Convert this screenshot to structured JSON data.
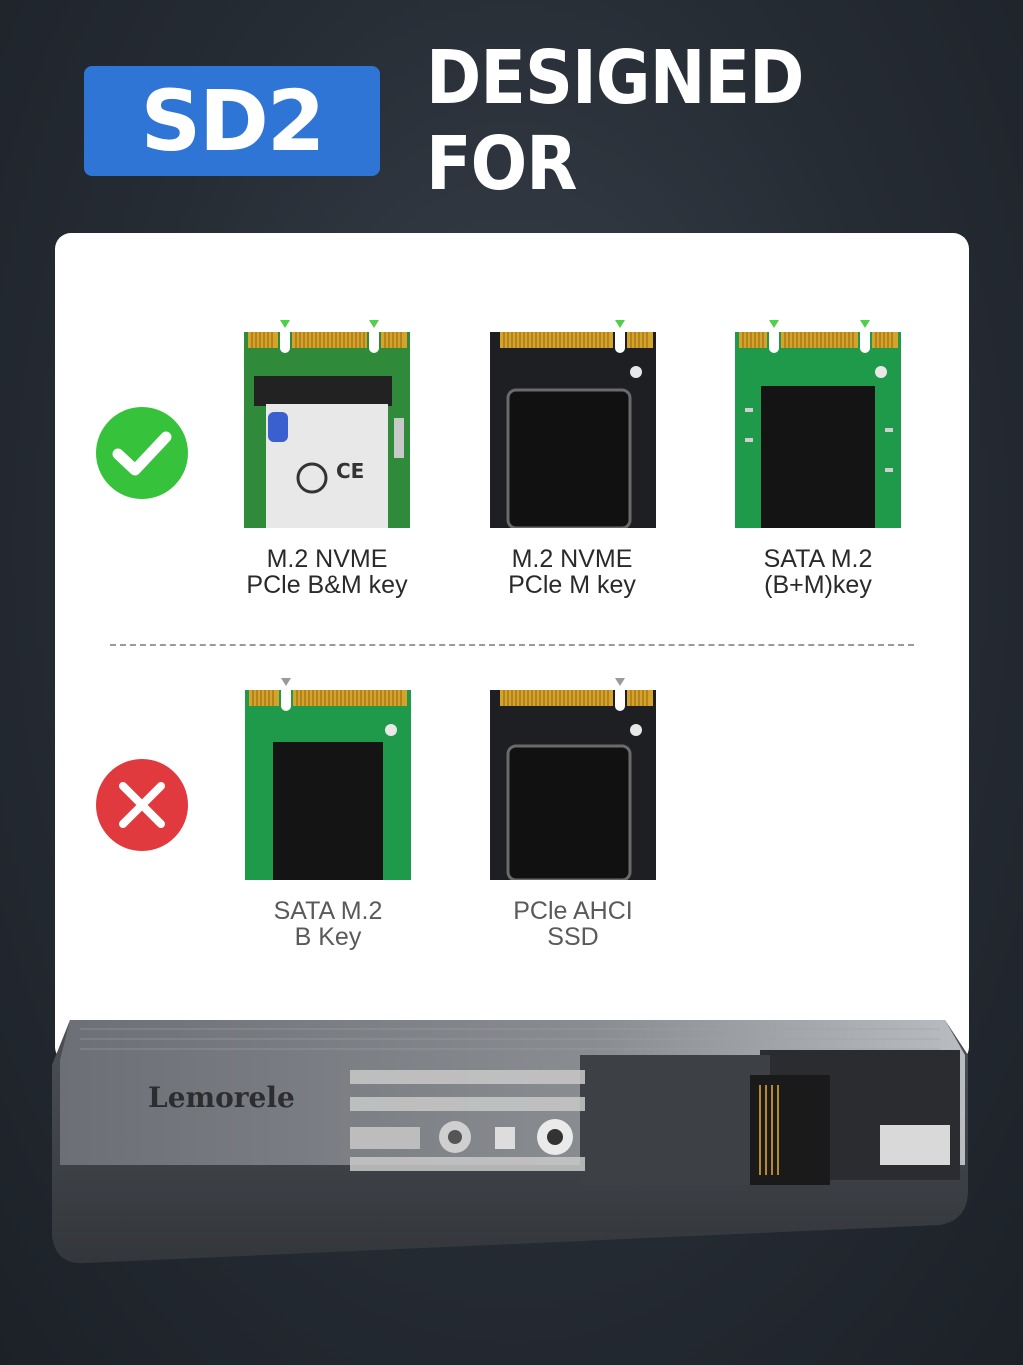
{
  "header": {
    "badge": "SD2",
    "title": "DESIGNED FOR"
  },
  "compatible": {
    "status": "check-icon",
    "color": "#36c23a",
    "items": [
      {
        "line1": "M.2 NVME",
        "line2": "PCle B&M key"
      },
      {
        "line1": "M.2 NVME",
        "line2": "PCle M key"
      },
      {
        "line1": "SATA M.2",
        "line2": "(B+M)key"
      }
    ]
  },
  "incompatible": {
    "status": "cross-icon",
    "color": "#e03a3e",
    "items": [
      {
        "line1": "SATA M.2",
        "line2": "B Key"
      },
      {
        "line1": "PCle AHCI",
        "line2": "SSD"
      }
    ]
  },
  "product": {
    "brand": "Lemorele"
  }
}
